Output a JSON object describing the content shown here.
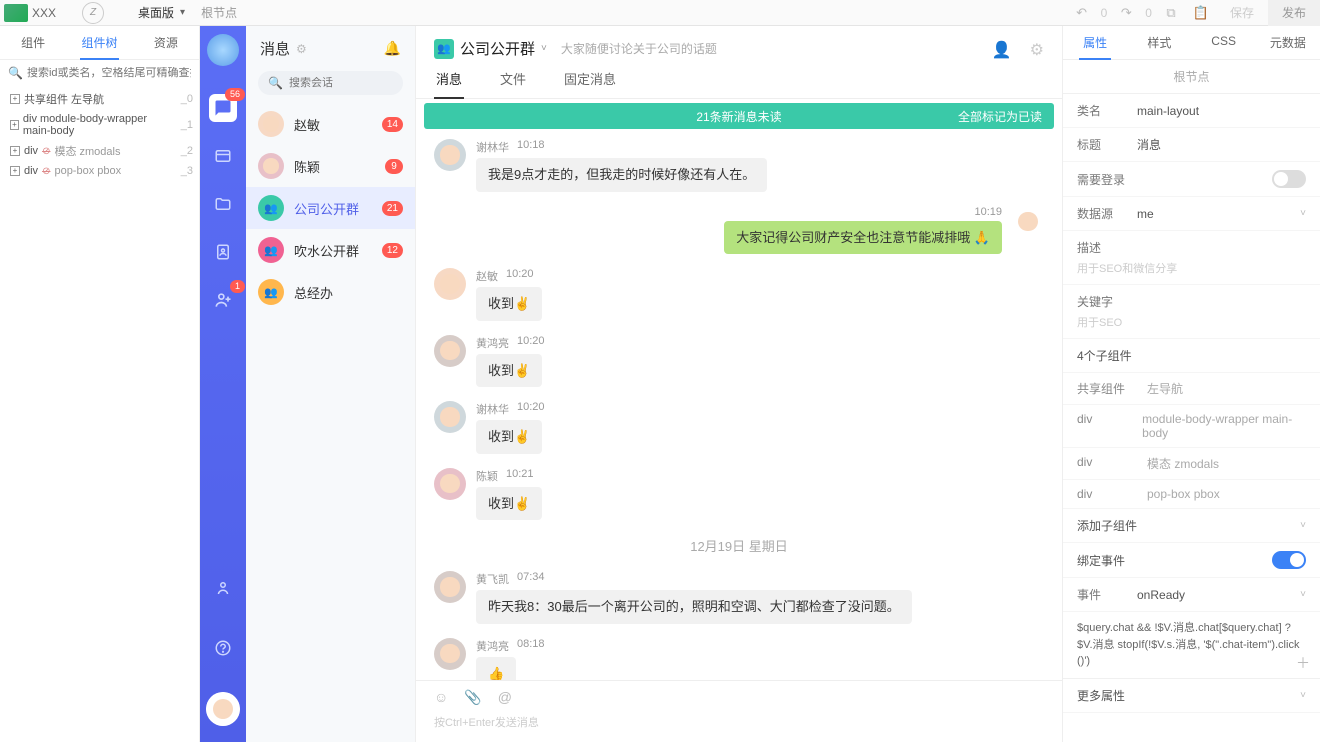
{
  "topbar": {
    "title": "XXX",
    "view_select": "桌面版",
    "root": "根节点",
    "undo_count": "0",
    "redo_count": "0",
    "save": "保存",
    "publish": "发布"
  },
  "left_tabs": {
    "components": "组件",
    "tree": "组件树",
    "resources": "资源"
  },
  "left_search_placeholder": "搜索id或类名，空格结尾可精确查找",
  "tree": [
    {
      "label": "共享组件 左导航",
      "idx": "_0"
    },
    {
      "label": "div  module-body-wrapper main-body",
      "idx": "_1"
    },
    {
      "label": "div",
      "strike": "模态 zmodals",
      "idx": "_2"
    },
    {
      "label": "div",
      "strike": "pop-box pbox",
      "idx": "_3"
    }
  ],
  "sidebar": {
    "chat_badge": "56",
    "contact_badge": "1"
  },
  "chatcol": {
    "title": "消息",
    "search_placeholder": "搜索会话",
    "items": [
      {
        "name": "赵敏",
        "badge": "14",
        "color": "#f7d9c4"
      },
      {
        "name": "陈颖",
        "badge": "9",
        "color": "#e8c0c8"
      },
      {
        "name": "公司公开群",
        "badge": "21",
        "color": "#3ac9a8",
        "active": true,
        "group": true
      },
      {
        "name": "吹水公开群",
        "badge": "12",
        "color": "#f06292",
        "group": true
      },
      {
        "name": "总经办",
        "badge": "",
        "color": "#ffb74d",
        "group": true
      }
    ]
  },
  "chat": {
    "title": "公司公开群",
    "desc": "大家随便讨论关于公司的话题",
    "tabs": {
      "msg": "消息",
      "file": "文件",
      "pinned": "固定消息"
    },
    "banner_text": "21条新消息未读",
    "banner_mark": "全部标记为已读",
    "date_divider": "12月19日 星期日",
    "messages": [
      {
        "author": "谢林华",
        "time": "10:18",
        "text": "我是9点才走的，但我走的时候好像还有人在。",
        "color": "#cfd8dc"
      },
      {
        "me": true,
        "time": "10:19",
        "text": "大家记得公司财产安全也注意节能减排哦 🙏"
      },
      {
        "author": "赵敏",
        "time": "10:20",
        "text": "收到✌️",
        "color": "#f7d9c4"
      },
      {
        "author": "黄鸿亮",
        "time": "10:20",
        "text": "收到✌️",
        "color": "#d7ccc8"
      },
      {
        "author": "谢林华",
        "time": "10:20",
        "text": "收到✌️",
        "color": "#cfd8dc"
      },
      {
        "author": "陈颖",
        "time": "10:21",
        "text": "收到✌️",
        "color": "#e8c0c8"
      }
    ],
    "messages_after": [
      {
        "author": "黄飞凯",
        "time": "07:34",
        "text": "昨天我8：30最后一个离开公司的，照明和空调、大门都检查了没问题。",
        "color": "#d7ccc8"
      },
      {
        "author": "黄鸿亮",
        "time": "08:18",
        "text": "👍",
        "color": "#d7ccc8"
      }
    ],
    "footer_hint": "按Ctrl+Enter发送消息"
  },
  "rpanel": {
    "tabs": {
      "props": "属性",
      "style": "样式",
      "css": "CSS",
      "meta": "元数据"
    },
    "breadcrumb": "根节点",
    "rows": {
      "class_k": "类名",
      "class_v": "main-layout",
      "title_k": "标题",
      "title_v": "消息",
      "login_k": "需要登录",
      "ds_k": "数据源",
      "ds_v": "me",
      "desc_k": "描述",
      "desc_hint": "用于SEO和微信分享",
      "keyword_k": "关键字",
      "keyword_hint": "用于SEO",
      "children_k": "4个子组件",
      "shared_k": "共享组件",
      "shared_v": "左导航",
      "addchild_k": "添加子组件",
      "bind_k": "绑定事件",
      "event_k": "事件",
      "event_v": "onReady",
      "code": "$query.chat && !$V.消息.chat[$query.chat] ? $V.消息\nstopIf(!$V.s.消息, '$(\".chat-item\").click()')",
      "more_k": "更多属性"
    },
    "children": [
      {
        "k": "div",
        "v": "module-body-wrapper main-body"
      },
      {
        "k": "div",
        "v": "模态 zmodals"
      },
      {
        "k": "div",
        "v": "pop-box pbox"
      }
    ]
  }
}
